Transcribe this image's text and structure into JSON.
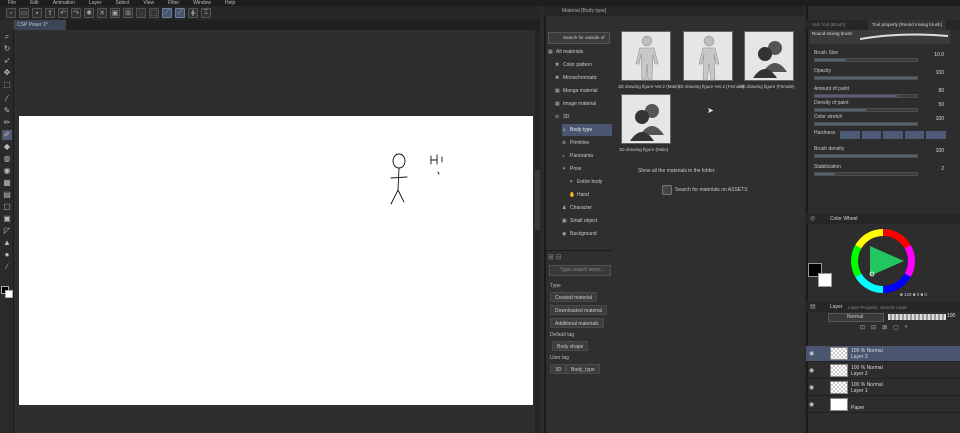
{
  "menu": [
    "File",
    "Edit",
    "Animation",
    "Layer",
    "Select",
    "View",
    "Filter",
    "Window",
    "Help"
  ],
  "document_tab": "CSP Poser 1*",
  "material_panel": {
    "title": "Material [Body type]",
    "search_placeholder": "Search for outside of",
    "tree": [
      {
        "label": "All materials",
        "level": 0,
        "icon": "grid-icon"
      },
      {
        "label": "Color pattern",
        "level": 1,
        "icon": "palette-icon"
      },
      {
        "label": "Monochromatic",
        "level": 1,
        "icon": "pattern-icon"
      },
      {
        "label": "Manga material",
        "level": 1,
        "icon": "manga-icon"
      },
      {
        "label": "Image material",
        "level": 1,
        "icon": "image-icon"
      },
      {
        "label": "3D",
        "level": 1,
        "icon": "3d-icon"
      },
      {
        "label": "Body type",
        "level": 2,
        "icon": "figure-icon",
        "selected": true
      },
      {
        "label": "Primitive",
        "level": 2,
        "icon": "primitive-icon"
      },
      {
        "label": "Panorama",
        "level": 2,
        "icon": "panorama-icon"
      },
      {
        "label": "Pose",
        "level": 2,
        "icon": "pose-icon"
      },
      {
        "label": "Entire body",
        "level": 3,
        "icon": "pose-icon"
      },
      {
        "label": "Hand",
        "level": 3,
        "icon": "hand-icon"
      },
      {
        "label": "Character",
        "level": 2,
        "icon": "character-icon"
      },
      {
        "label": "Small object",
        "level": 2,
        "icon": "object-icon"
      },
      {
        "label": "Background",
        "level": 2,
        "icon": "background-icon"
      }
    ],
    "tag_search_placeholder": "Type search keyw...",
    "type_heading": "Type",
    "type_tags": [
      "Created material",
      "Downloaded material",
      "Additional materials"
    ],
    "default_tag_heading": "Default tag",
    "default_tags": [
      "Body shape"
    ],
    "user_tag_heading": "User tag",
    "user_tags": [
      "3D",
      "Body_type"
    ],
    "materials": [
      {
        "caption": "3D drawing figure-Ver.2 (Male)",
        "kind": "figure-male"
      },
      {
        "caption": "3D drawing figure-Ver.2 (Female)",
        "kind": "figure-female"
      },
      {
        "caption": "3D drawing figure (Female)",
        "kind": "silhouette"
      },
      {
        "caption": "3D drawing figure (Male)",
        "kind": "silhouette"
      }
    ],
    "show_all": "Show all the materials in the folder.",
    "assets_link": "Search for materials on ASSETS"
  },
  "tool_property": {
    "tabs": [
      "Sub Tool [Brush]",
      "Tool property [Round mixing brush]"
    ],
    "brush_name": "Round mixing brush",
    "props": [
      {
        "label": "Brush Size",
        "value": "10.0",
        "fill": 0.3
      },
      {
        "label": "Opacity",
        "value": "100",
        "fill": 1.0
      },
      {
        "label": "Amount of paint",
        "value": "80",
        "fill": 0.8
      },
      {
        "label": "Density of paint",
        "value": "50",
        "fill": 0.5
      },
      {
        "label": "Color stretch",
        "value": "100",
        "fill": 1.0
      },
      {
        "label": "Hardness",
        "value": "",
        "fill": 0
      },
      {
        "label": "Brush density",
        "value": "100",
        "fill": 1.0
      },
      {
        "label": "Stabilization",
        "value": "2",
        "fill": 0.2
      }
    ]
  },
  "color_panel": {
    "title": "Color Wheel",
    "readout": "■ 120  ■ 0  ■ 0",
    "main_color": "#000000",
    "sub_color": "#ffffff",
    "hue_color": "#22c55e"
  },
  "layer_panel": {
    "title": "Layer",
    "tabs": [
      "Layer Property",
      "Search Layer"
    ],
    "blend_mode": "Normal",
    "opacity": "100",
    "layers": [
      {
        "line1": "100 % Normal",
        "line2": "Layer 3",
        "selected": true,
        "checker": true
      },
      {
        "line1": "100 % Normal",
        "line2": "Layer 2",
        "selected": false,
        "checker": true
      },
      {
        "line1": "100 % Normal",
        "line2": "Layer 1",
        "selected": false,
        "checker": true
      },
      {
        "line1": "",
        "line2": "Paper",
        "selected": false,
        "checker": false
      }
    ]
  },
  "canvas_doodle_text": "Hi"
}
